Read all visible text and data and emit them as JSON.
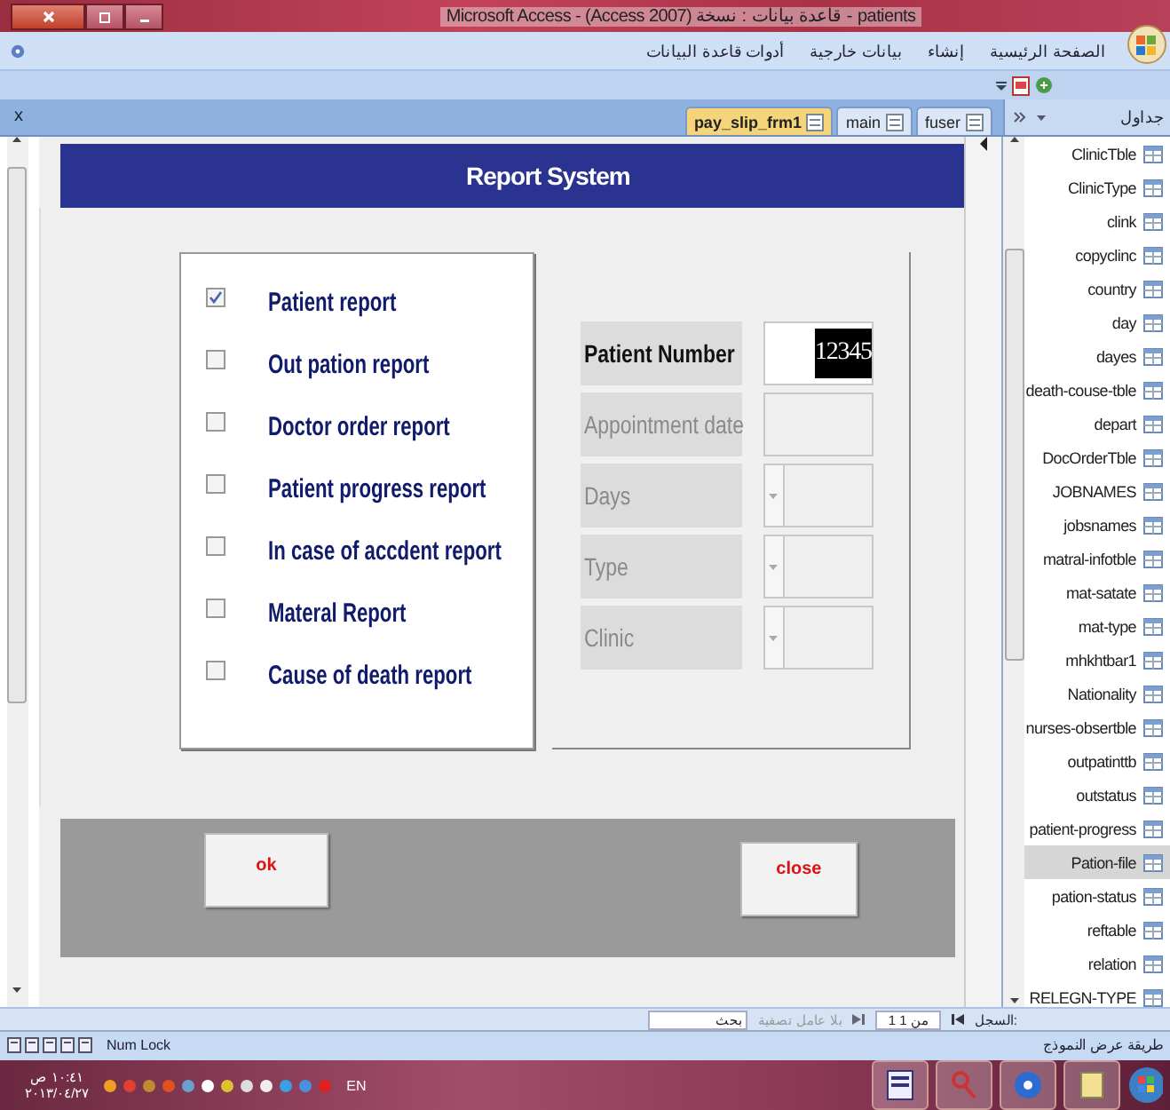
{
  "window": {
    "title": "Microsoft Access - (Access 2007) قاعدة بيانات : نسخة - patients"
  },
  "ribbon_tabs": [
    {
      "label": "الصفحة الرئيسية"
    },
    {
      "label": "إنشاء"
    },
    {
      "label": "بيانات خارجية"
    },
    {
      "label": "أدوات قاعدة البيانات"
    }
  ],
  "document_tabs": {
    "close_label": "x",
    "tabs": [
      {
        "label": "pay_slip_frm1",
        "selected": true
      },
      {
        "label": "main",
        "selected": false
      },
      {
        "label": "fuser",
        "selected": false
      }
    ]
  },
  "navigation_pane": {
    "title": "جداول",
    "items": [
      {
        "label": "ClinicTble",
        "selected": false
      },
      {
        "label": "ClinicType",
        "selected": false
      },
      {
        "label": "clink",
        "selected": false
      },
      {
        "label": "copyclinc",
        "selected": false
      },
      {
        "label": "country",
        "selected": false
      },
      {
        "label": "day",
        "selected": false
      },
      {
        "label": "dayes",
        "selected": false
      },
      {
        "label": "death-couse-tble",
        "selected": false
      },
      {
        "label": "depart",
        "selected": false
      },
      {
        "label": "DocOrderTble",
        "selected": false
      },
      {
        "label": "JOBNAMES",
        "selected": false
      },
      {
        "label": "jobsnames",
        "selected": false
      },
      {
        "label": "matral-infotble",
        "selected": false
      },
      {
        "label": "mat-satate",
        "selected": false
      },
      {
        "label": "mat-type",
        "selected": false
      },
      {
        "label": "mhkhtbar1",
        "selected": false
      },
      {
        "label": "Nationality",
        "selected": false
      },
      {
        "label": "nurses-obsertble",
        "selected": false
      },
      {
        "label": "outpatinttb",
        "selected": false
      },
      {
        "label": "outstatus",
        "selected": false
      },
      {
        "label": "patient-progress",
        "selected": false
      },
      {
        "label": "Pation-file",
        "selected": true
      },
      {
        "label": "pation-status",
        "selected": false
      },
      {
        "label": "reftable",
        "selected": false
      },
      {
        "label": "relation",
        "selected": false
      },
      {
        "label": "RELEGN-TYPE",
        "selected": false
      }
    ]
  },
  "form": {
    "title": "Report System",
    "reports": [
      {
        "label": "Patient report",
        "checked": true
      },
      {
        "label": "Out pation report",
        "checked": false
      },
      {
        "label": "Doctor order report",
        "checked": false
      },
      {
        "label": "Patient progress report",
        "checked": false
      },
      {
        "label": "In case of accdent report",
        "checked": false
      },
      {
        "label": "Materal Report",
        "checked": false
      },
      {
        "label": "Cause of death report",
        "checked": false
      }
    ],
    "parameters": [
      {
        "label": "Patient Number",
        "kind": "text",
        "disabled": false,
        "value": "12345"
      },
      {
        "label": "Appointment date",
        "kind": "text",
        "disabled": true
      },
      {
        "label": "Days",
        "kind": "combo",
        "disabled": true
      },
      {
        "label": "Type",
        "kind": "combo",
        "disabled": true
      },
      {
        "label": "Clinic",
        "kind": "combo",
        "disabled": true
      }
    ],
    "buttons": [
      "ok",
      "close"
    ]
  },
  "record_navigator": {
    "label": "السجل:",
    "position": "1 من 1",
    "filter": "بلا عامل تصفية",
    "search": "بحث"
  },
  "status_bar": {
    "indicator": "Num Lock",
    "view": "طريقة عرض النموذج"
  },
  "taskbar": {
    "time": "١٠:٤١ ص",
    "date": "٢٠١٣/٠٤/٢٧",
    "language": "EN"
  }
}
